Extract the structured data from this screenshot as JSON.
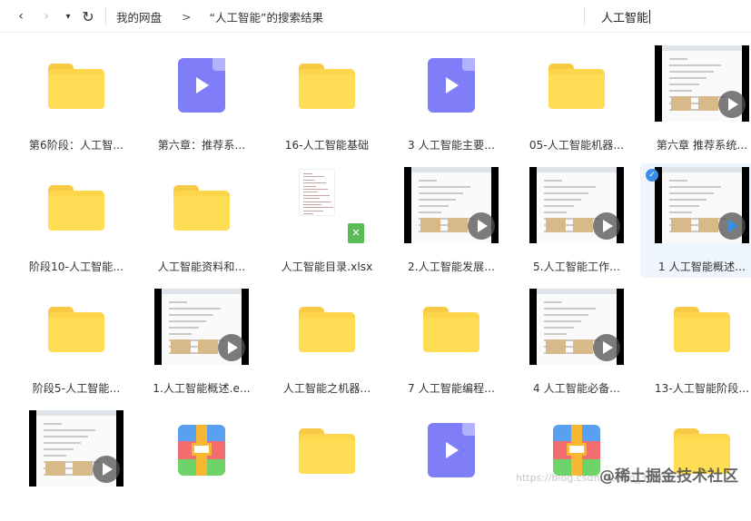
{
  "toolbar": {
    "back": "‹",
    "forward": "›",
    "dropdown": "▾",
    "refresh": "↻",
    "breadcrumb_root": "我的网盘",
    "breadcrumb_sep": ">",
    "breadcrumb_current": "“人工智能”的搜索结果",
    "search_value": "人工智能"
  },
  "items": [
    {
      "label": "第6阶段：人工智...",
      "type": "folder"
    },
    {
      "label": "第六章：推荐系...",
      "type": "video"
    },
    {
      "label": "16-人工智能基础",
      "type": "folder"
    },
    {
      "label": "3 人工智能主要...",
      "type": "video"
    },
    {
      "label": "05-人工智能机器...",
      "type": "folder"
    },
    {
      "label": "第六章 推荐系统...",
      "type": "video-thumb"
    },
    {
      "label": "阶段10-人工智能...",
      "type": "folder"
    },
    {
      "label": "人工智能资料和...",
      "type": "folder"
    },
    {
      "label": "人工智能目录.xlsx",
      "type": "xlsx"
    },
    {
      "label": "2.人工智能发展...",
      "type": "video-thumb"
    },
    {
      "label": "5.人工智能工作...",
      "type": "video-thumb"
    },
    {
      "label": "1 人工智能概述...",
      "type": "video-thumb",
      "selected": true
    },
    {
      "label": "阶段5-人工智能...",
      "type": "folder"
    },
    {
      "label": "1.人工智能概述.e...",
      "type": "video-thumb"
    },
    {
      "label": "人工智能之机器...",
      "type": "folder"
    },
    {
      "label": "7 人工智能编程...",
      "type": "folder"
    },
    {
      "label": "4 人工智能必备...",
      "type": "video-thumb"
    },
    {
      "label": "13-人工智能阶段...",
      "type": "folder"
    },
    {
      "label": "",
      "type": "video-thumb"
    },
    {
      "label": "",
      "type": "rar"
    },
    {
      "label": "",
      "type": "folder"
    },
    {
      "label": "",
      "type": "video"
    },
    {
      "label": "",
      "type": "rar"
    },
    {
      "label": "",
      "type": "folder"
    }
  ],
  "watermark": {
    "main": "@稀土掘金技术社区",
    "url": "https://blog.csdn.net/qq_30001"
  },
  "colors": {
    "folder": "#ffdd55",
    "video": "#7f7ef8",
    "selected": "#eef5fc",
    "accent": "#3a8ee6"
  }
}
